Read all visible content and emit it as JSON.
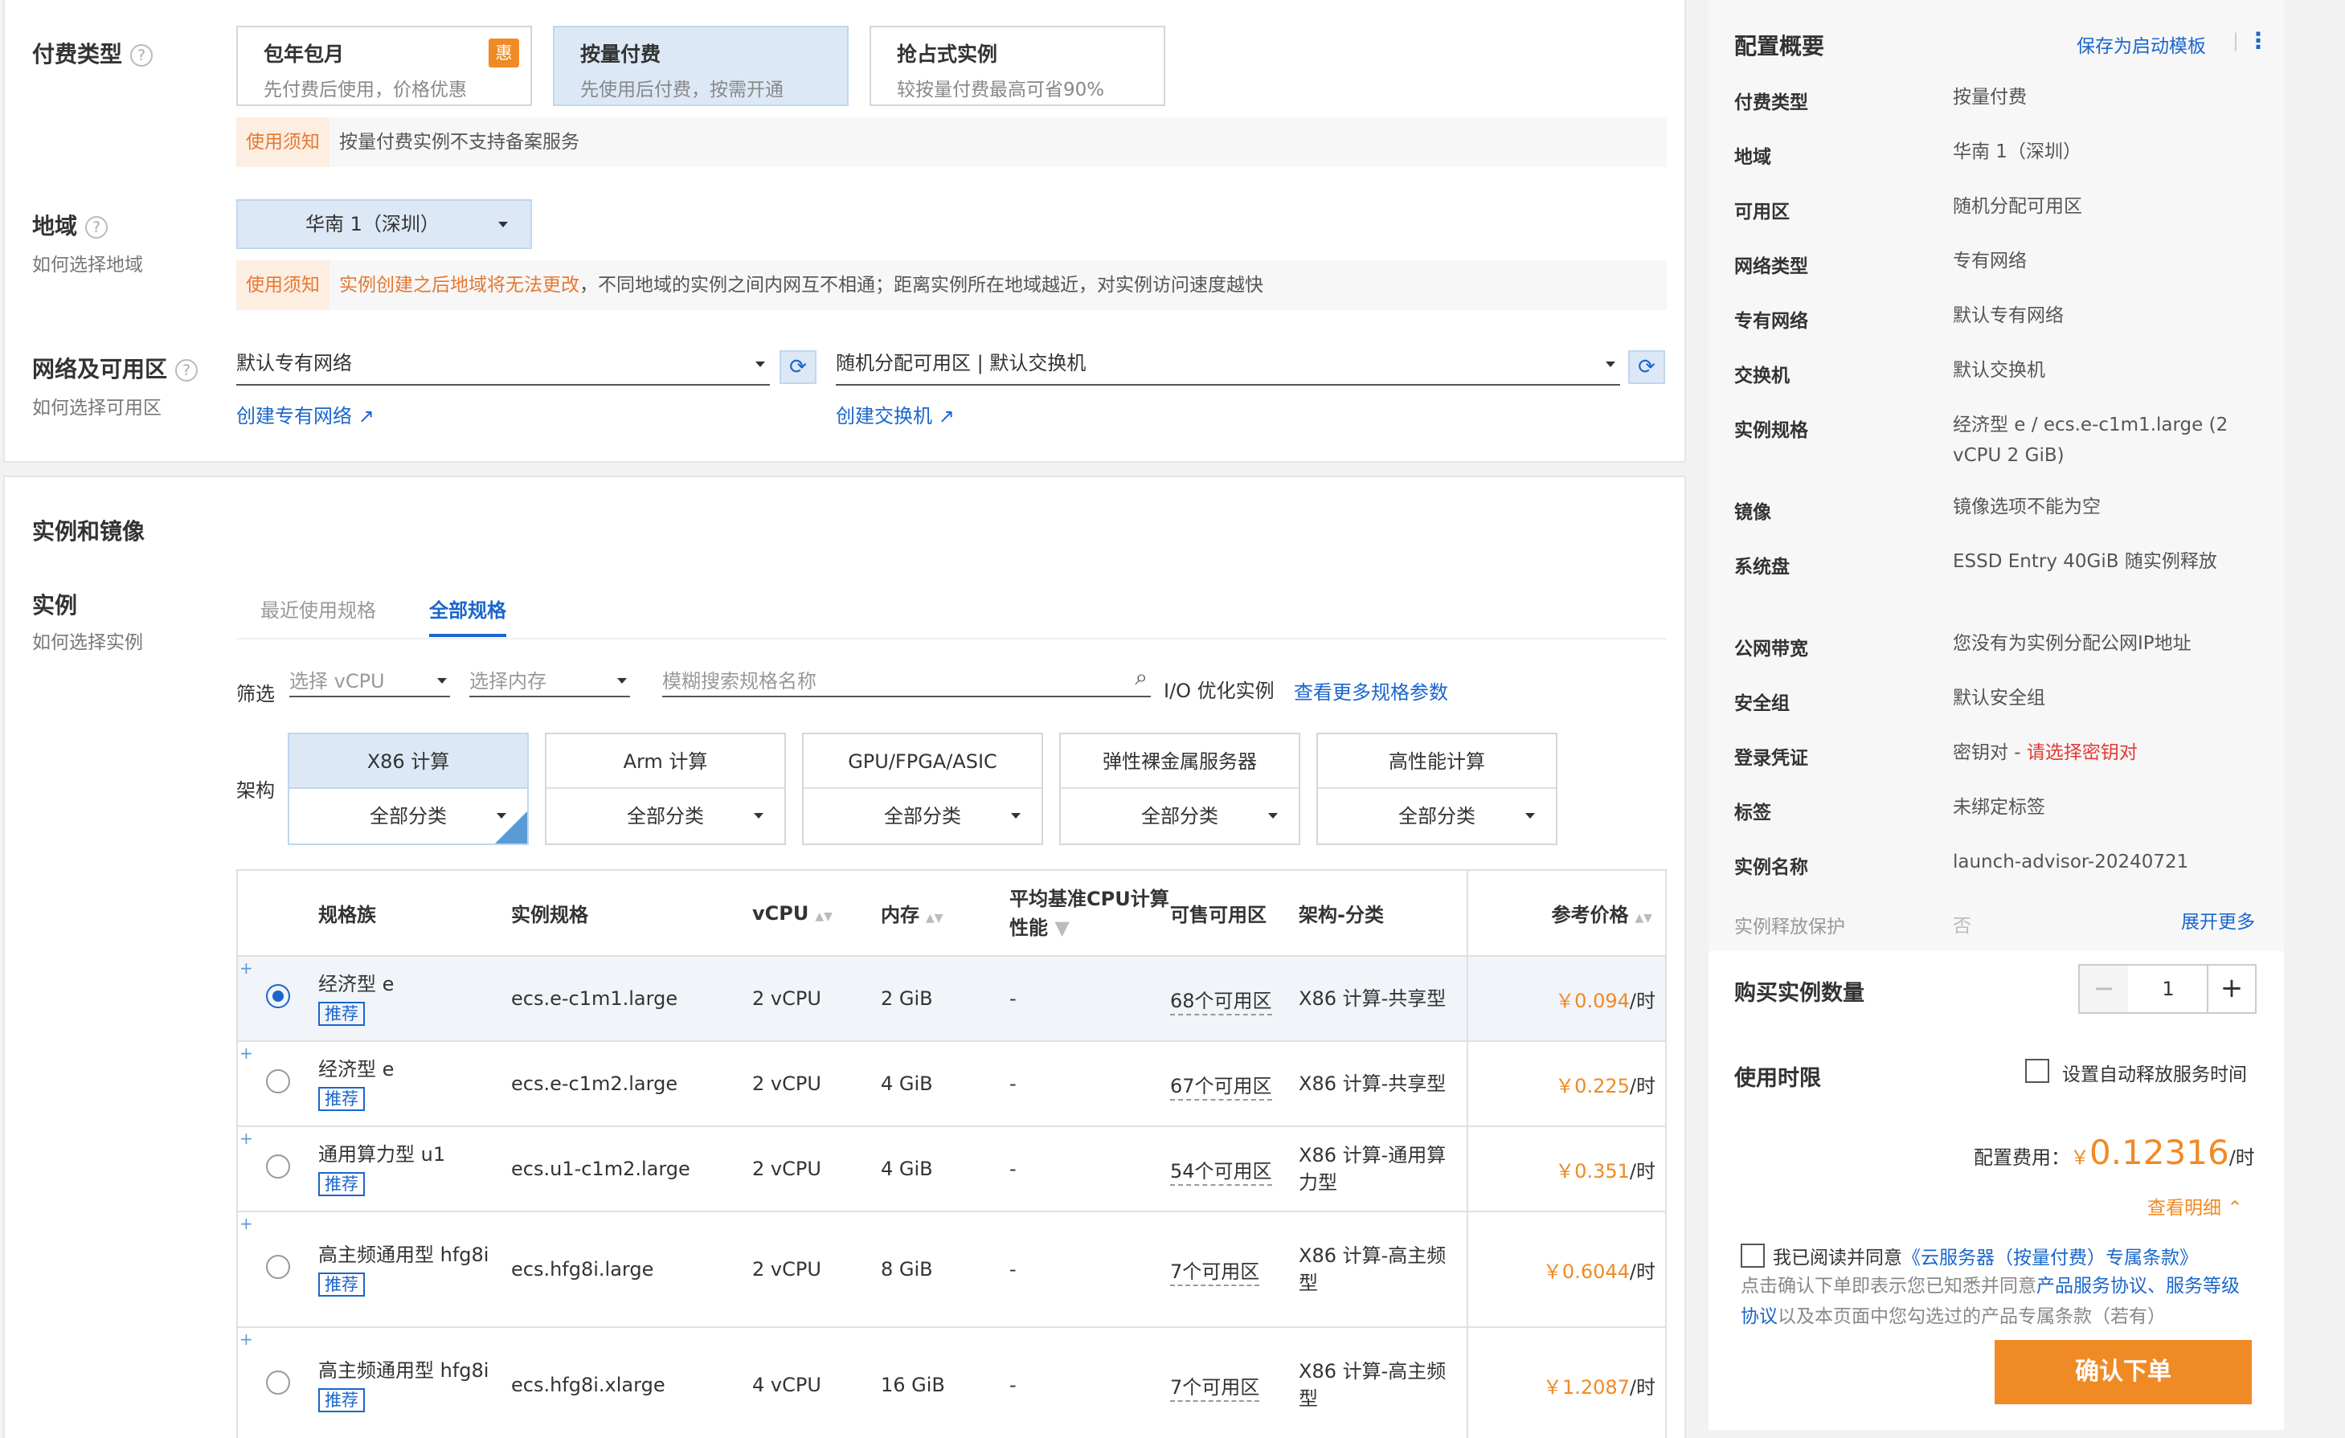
{
  "billing": {
    "label": "付费类型",
    "options": [
      {
        "title": "包年包月",
        "desc": "先付费后使用，价格优惠",
        "badge": "惠"
      },
      {
        "title": "按量付费",
        "desc": "先使用后付费，按需开通"
      },
      {
        "title": "抢占式实例",
        "desc": "较按量付费最高可省90%"
      }
    ],
    "notice_tag": "使用须知",
    "notice_text": "按量付费实例不支持备案服务"
  },
  "region": {
    "label": "地域",
    "sub": "如何选择地域",
    "value": "华南 1（深圳）",
    "notice_tag": "使用须知",
    "notice_warn": "实例创建之后地域将无法更改",
    "notice_text": "，不同地域的实例之间内网互不相通；距离实例所在地域越近，对实例访问速度越快"
  },
  "network": {
    "label": "网络及可用区",
    "sub": "如何选择可用区",
    "vpc": "默认专有网络",
    "zone": "随机分配可用区 | 默认交换机",
    "create_vpc": "创建专有网络",
    "create_switch": "创建交换机"
  },
  "instance_section": {
    "title": "实例和镜像",
    "label": "实例",
    "sub": "如何选择实例",
    "tabs": [
      "最近使用规格",
      "全部规格"
    ],
    "filter_label": "筛选",
    "vcpu_placeholder": "选择 vCPU",
    "mem_placeholder": "选择内存",
    "search_placeholder": "模糊搜索规格名称",
    "io_opt": "I/O 优化实例",
    "more_params": "查看更多规格参数",
    "arch_label": "架构",
    "archs": [
      {
        "name": "X86 计算",
        "sub": "全部分类"
      },
      {
        "name": "Arm 计算",
        "sub": "全部分类"
      },
      {
        "name": "GPU/FPGA/ASIC",
        "sub": "全部分类"
      },
      {
        "name": "弹性裸金属服务器",
        "sub": "全部分类"
      },
      {
        "name": "高性能计算",
        "sub": "全部分类"
      }
    ]
  },
  "table": {
    "headers": [
      "规格族",
      "实例规格",
      "vCPU",
      "内存",
      "平均基准CPU计算性能",
      "可售可用区",
      "架构-分类",
      "参考价格"
    ],
    "recommend": "推荐",
    "rows": [
      {
        "family": "经济型 e",
        "spec": "ecs.e-c1m1.large",
        "vcpu": "2 vCPU",
        "mem": "2 GiB",
        "perf": "-",
        "zones": "68个可用区",
        "arch": "X86 计算-共享型",
        "price": "￥0.094",
        "unit": "/时"
      },
      {
        "family": "经济型 e",
        "spec": "ecs.e-c1m2.large",
        "vcpu": "2 vCPU",
        "mem": "4 GiB",
        "perf": "-",
        "zones": "67个可用区",
        "arch": "X86 计算-共享型",
        "price": "￥0.225",
        "unit": "/时"
      },
      {
        "family": "通用算力型 u1",
        "spec": "ecs.u1-c1m2.large",
        "vcpu": "2 vCPU",
        "mem": "4 GiB",
        "perf": "-",
        "zones": "54个可用区",
        "arch": "X86 计算-通用算力型",
        "price": "￥0.351",
        "unit": "/时"
      },
      {
        "family": "高主频通用型 hfg8i",
        "spec": "ecs.hfg8i.large",
        "vcpu": "2 vCPU",
        "mem": "8 GiB",
        "perf": "-",
        "zones": "7个可用区",
        "arch": "X86 计算-高主频型",
        "price": "￥0.6044",
        "unit": "/时"
      },
      {
        "family": "高主频通用型 hfg8i",
        "spec": "ecs.hfg8i.xlarge",
        "vcpu": "4 vCPU",
        "mem": "16 GiB",
        "perf": "-",
        "zones": "7个可用区",
        "arch": "X86 计算-高主频型",
        "price": "￥1.2087",
        "unit": "/时"
      }
    ]
  },
  "summary": {
    "title": "配置概要",
    "save_template": "保存为启动模板",
    "rows": [
      {
        "k": "付费类型",
        "v": "按量付费"
      },
      {
        "k": "地域",
        "v": "华南 1（深圳）"
      },
      {
        "k": "可用区",
        "v": "随机分配可用区"
      },
      {
        "k": "网络类型",
        "v": "专有网络"
      },
      {
        "k": "专有网络",
        "v": "默认专有网络"
      },
      {
        "k": "交换机",
        "v": "默认交换机"
      },
      {
        "k": "实例规格",
        "v": "经济型 e / ecs.e-c1m1.large (2 vCPU 2 GiB)"
      },
      {
        "k": "镜像",
        "v": "镜像选项不能为空"
      },
      {
        "k": "系统盘",
        "v": "ESSD Entry 40GiB 随实例释放"
      },
      {
        "k": "公网带宽",
        "v": "您没有为实例分配公网IP地址"
      },
      {
        "k": "安全组",
        "v": "默认安全组"
      },
      {
        "k": "登录凭证",
        "v": "密钥对 - ",
        "v_red": "请选择密钥对"
      },
      {
        "k": "标签",
        "v": "未绑定标签"
      },
      {
        "k": "实例名称",
        "v": "launch-advisor-20240721"
      }
    ],
    "release_k": "实例释放保护",
    "release_v": "否",
    "expand": "展开更多",
    "qty_label": "购买实例数量",
    "qty": "1",
    "duration_label": "使用时限",
    "auto_release": "设置自动释放服务时间",
    "fee_label": "配置费用：",
    "fee_currency": "￥",
    "fee_value": "0.12316",
    "fee_unit": "/时",
    "detail": "查看明细",
    "agree_pre": "我已阅读并同意",
    "agree_link": "《云服务器（按量付费）专属条款》",
    "agree_note_1": "点击确认下单即表示您已知悉并同意",
    "agree_note_link1": "产品服务协议、服务等级协议",
    "agree_note_2": "以及本页面中您勾选过的产品专属条款（若有）",
    "confirm": "确认下单"
  }
}
